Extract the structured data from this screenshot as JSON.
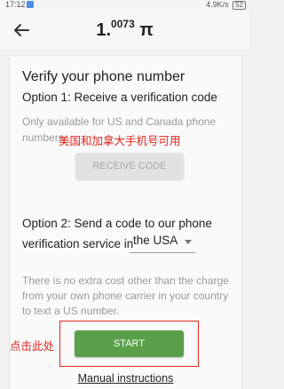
{
  "statusbar": {
    "time": "17:12",
    "right": "4.9K/s",
    "battery": "52"
  },
  "appbar": {
    "brand_main": "1.",
    "brand_sup": "0073",
    "brand_pi": "π"
  },
  "verify": {
    "heading": "Verify your phone number",
    "option1": "Option 1: Receive a verification code",
    "option1_note": "Only available for US and Canada phone numbers.",
    "annotation_cn1": "美国和加拿大手机号可用",
    "receive_label": "RECEIVE CODE",
    "option2": "Option 2: Send a code to our phone verification service in",
    "country_selected": "the USA",
    "option2_note": "There is no extra cost other than the charge from your own phone carrier in your country to text a US number.",
    "annotation_cn2": "点击此处",
    "start_label": "START",
    "manual_label": "Manual instructions"
  },
  "colors": {
    "accent": "#5aa04a",
    "annotation": "#e0261d"
  }
}
